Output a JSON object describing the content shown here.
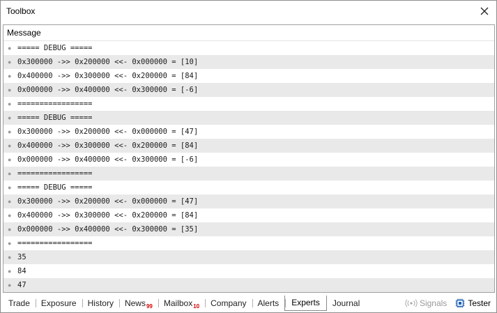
{
  "window": {
    "title": "Toolbox"
  },
  "table": {
    "header": "Message",
    "rows": [
      "===== DEBUG =====",
      "0x300000 ->> 0x200000 <<- 0x000000 = [10]",
      "0x400000 ->> 0x300000 <<- 0x200000 = [84]",
      "0x000000 ->> 0x400000 <<- 0x300000 = [-6]",
      "=================",
      "===== DEBUG =====",
      "0x300000 ->> 0x200000 <<- 0x000000 = [47]",
      "0x400000 ->> 0x300000 <<- 0x200000 = [84]",
      "0x000000 ->> 0x400000 <<- 0x300000 = [-6]",
      "=================",
      "===== DEBUG =====",
      "0x300000 ->> 0x200000 <<- 0x000000 = [47]",
      "0x400000 ->> 0x300000 <<- 0x200000 = [84]",
      "0x000000 ->> 0x400000 <<- 0x300000 = [35]",
      "=================",
      "35",
      "84",
      "47"
    ]
  },
  "tabs": {
    "trade": "Trade",
    "exposure": "Exposure",
    "history": "History",
    "news": "News",
    "news_badge": "99",
    "mailbox": "Mailbox",
    "mailbox_badge": "10",
    "company": "Company",
    "alerts": "Alerts",
    "experts": "Experts",
    "journal": "Journal",
    "active": "experts"
  },
  "status": {
    "signals": "Signals",
    "tester": "Tester"
  },
  "colors": {
    "badge": "#d40000",
    "row_alt": "#e9e9e9",
    "tester_icon": "#1e5fb4"
  },
  "icons": {
    "close": "close-icon",
    "signals": "signals-icon",
    "tester": "tester-icon"
  }
}
